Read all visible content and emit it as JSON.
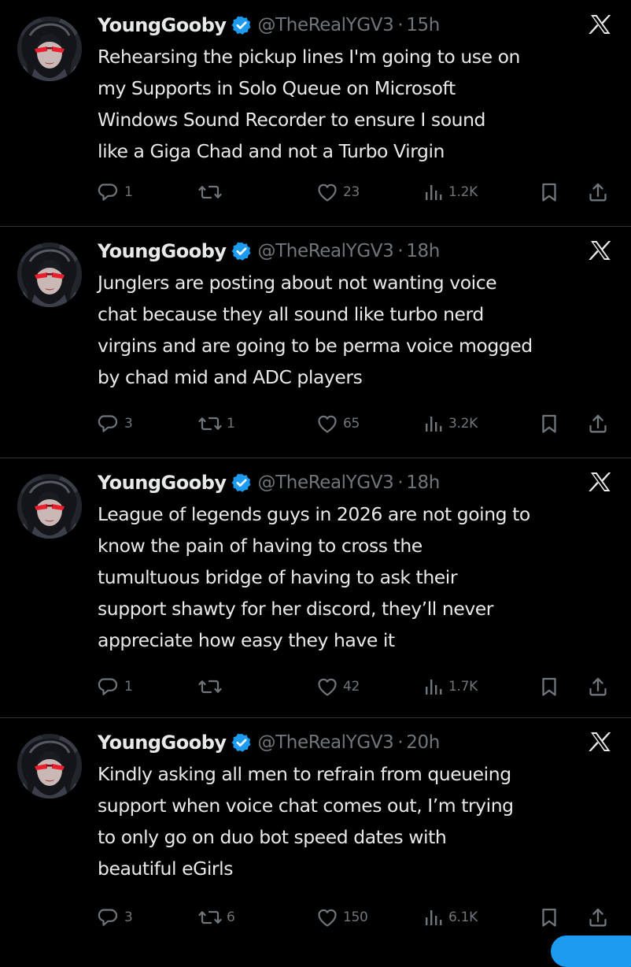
{
  "colors": {
    "background": "#000000",
    "text_primary": "#e7e9ea",
    "text_secondary": "#71767b",
    "divider": "#2f3336",
    "verified_badge": "#1d9bf0",
    "compose_button": "#1d9bf0"
  },
  "icons": {
    "reply": "reply-bubble-icon",
    "retweet": "retweet-arrows-icon",
    "like": "heart-icon",
    "views": "bar-chart-icon",
    "bookmark": "bookmark-icon",
    "share": "share-upload-icon",
    "platform": "x-logo-icon",
    "verified": "verified-badge-icon"
  },
  "tweets": [
    {
      "author_name": "YoungGooby",
      "handle": "@TheRealYGV3",
      "separator": "·",
      "time": "15h",
      "text": "Rehearsing the pickup lines I'm going to use on\nmy Supports in Solo Queue on Microsoft\nWindows Sound Recorder to ensure I sound\nlike a Giga Chad and not a Turbo Virgin",
      "replies": "1",
      "retweets": "",
      "likes": "23",
      "views": "1.2K"
    },
    {
      "author_name": "YoungGooby",
      "handle": "@TheRealYGV3",
      "separator": "·",
      "time": "18h",
      "text": "Junglers are posting about not wanting voice\nchat because they all sound like turbo nerd\nvirgins and are going to be perma voice mogged\nby chad mid and ADC players",
      "replies": "3",
      "retweets": "1",
      "likes": "65",
      "views": "3.2K"
    },
    {
      "author_name": "YoungGooby",
      "handle": "@TheRealYGV3",
      "separator": "·",
      "time": "18h",
      "text": "League of legends guys in 2026 are not going to\nknow the pain of having to cross the\ntumultuous bridge of having to ask their\nsupport shawty for her discord, they’ll never\nappreciate how easy they have it",
      "replies": "1",
      "retweets": "",
      "likes": "42",
      "views": "1.7K"
    },
    {
      "author_name": "YoungGooby",
      "handle": "@TheRealYGV3",
      "separator": "·",
      "time": "20h",
      "text": "Kindly asking all men to refrain from queueing\nsupport when voice chat comes out, I’m trying\nto only go on duo bot speed dates with\nbeautiful eGirls",
      "replies": "3",
      "retweets": "6",
      "likes": "150",
      "views": "6.1K"
    }
  ]
}
